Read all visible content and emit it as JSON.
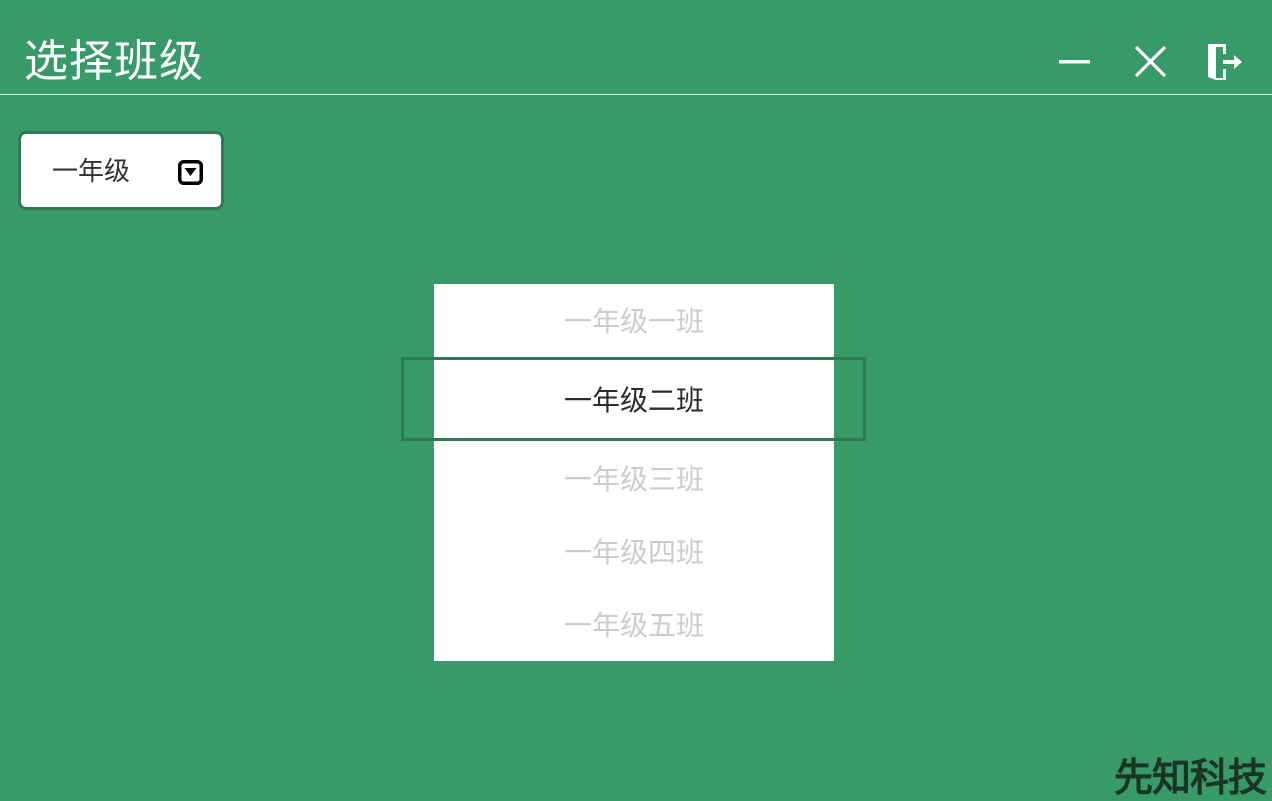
{
  "header": {
    "title": "选择班级",
    "minimize_icon": "minimize-icon",
    "close_icon": "close-icon",
    "exit_icon": "exit-door-icon"
  },
  "grade_select": {
    "value": "一年级",
    "arrow_icon": "dropdown-arrow-icon"
  },
  "class_picker": {
    "items": [
      {
        "label": "一年级一班",
        "selected": false
      },
      {
        "label": "一年级二班",
        "selected": true
      },
      {
        "label": "一年级三班",
        "selected": false
      },
      {
        "label": "一年级四班",
        "selected": false
      },
      {
        "label": "一年级五班",
        "selected": false
      }
    ]
  },
  "watermark": "先知科技",
  "colors": {
    "background": "#399a69",
    "accent_border": "#2f7a54",
    "selected_text": "#2b2b2b",
    "unselected_text": "#cccccc"
  }
}
